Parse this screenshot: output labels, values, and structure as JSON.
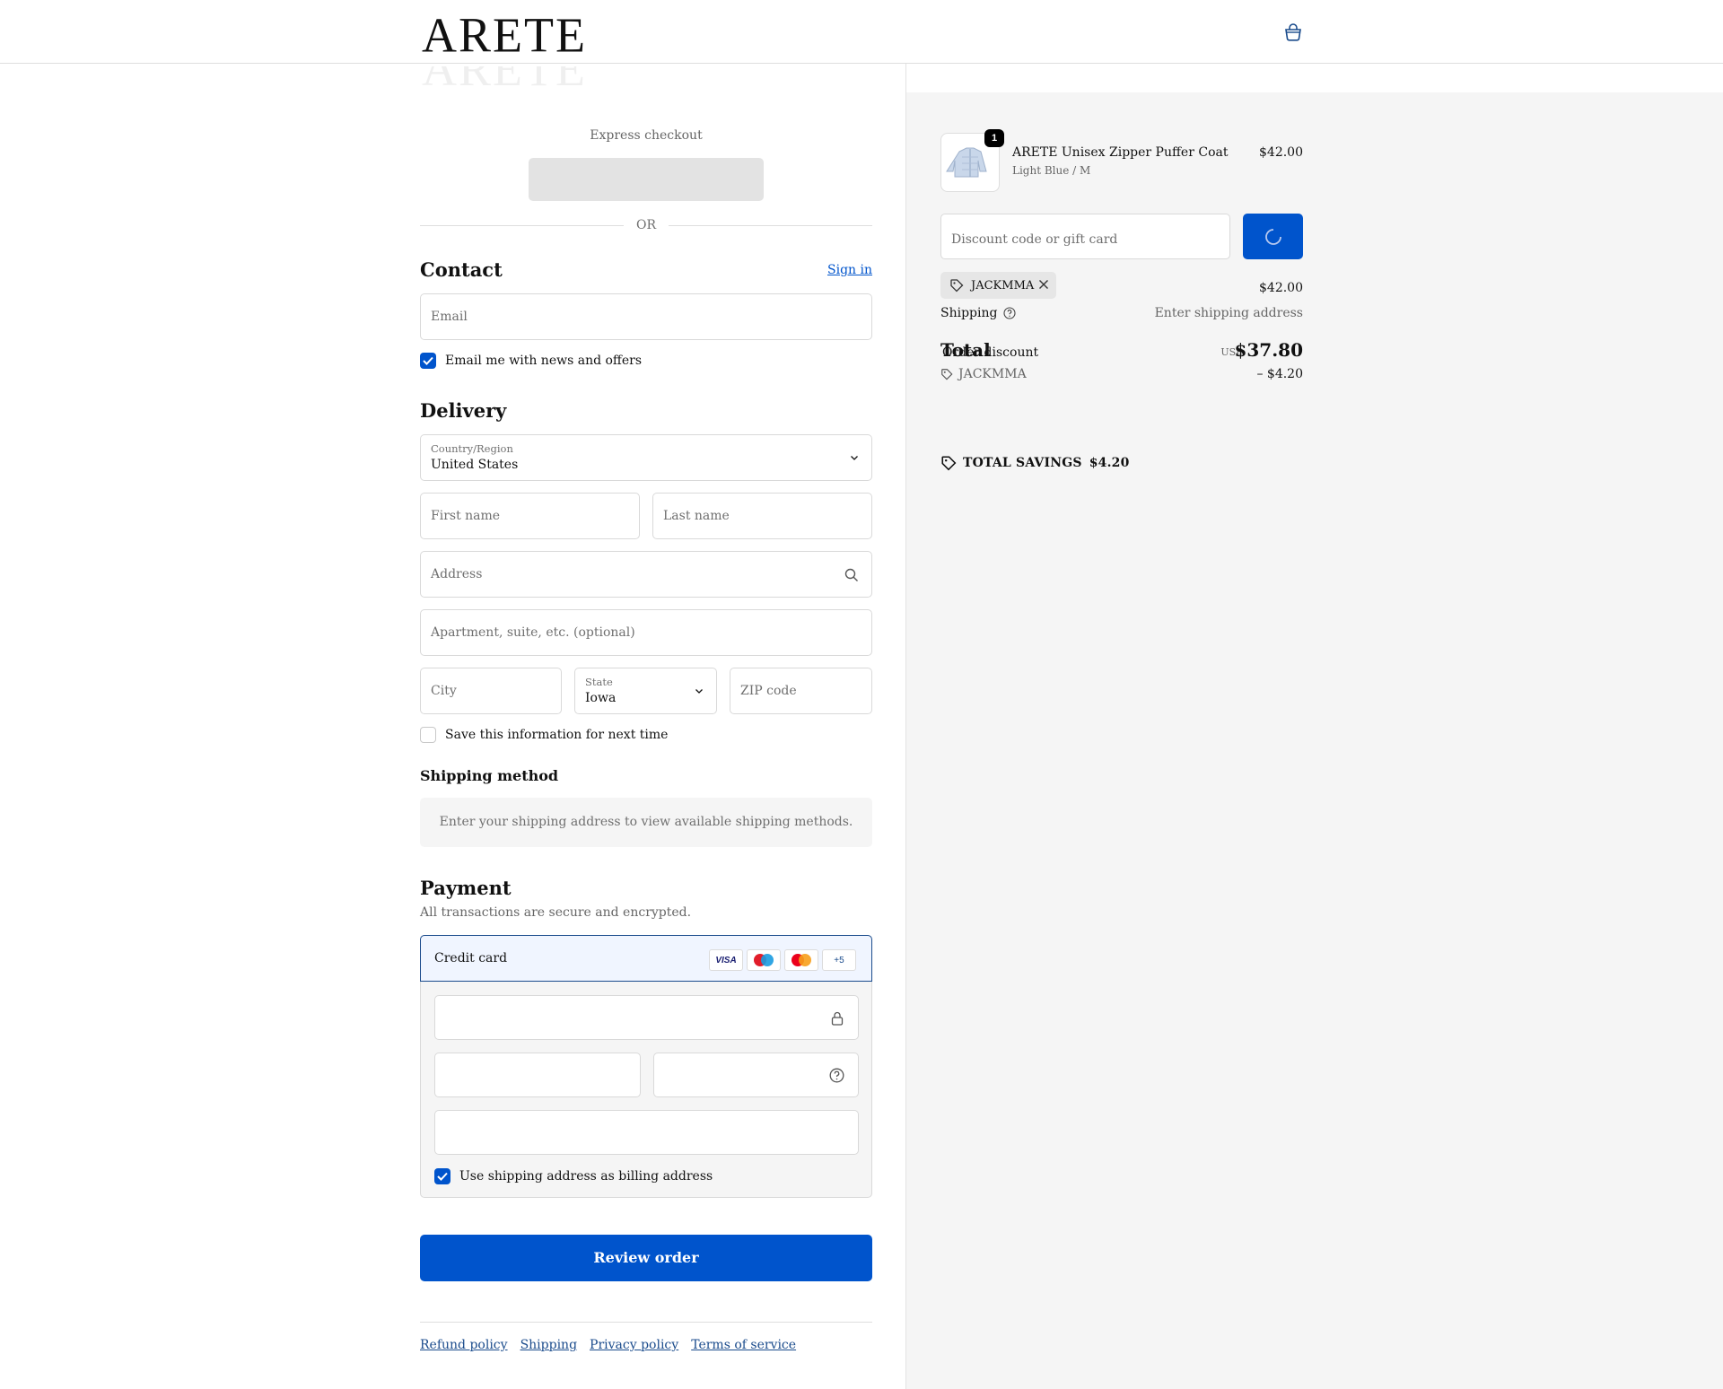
{
  "brand": {
    "logo_text": "ARETE"
  },
  "express": {
    "label": "Express checkout",
    "or_text": "OR"
  },
  "contact": {
    "title": "Contact",
    "sign_in": "Sign in",
    "email_placeholder": "Email",
    "news_label": "Email me with news and offers",
    "news_checked": true
  },
  "delivery": {
    "title": "Delivery",
    "country_label": "Country/Region",
    "country_value": "United States",
    "first_name_placeholder": "First name",
    "last_name_placeholder": "Last name",
    "address_placeholder": "Address",
    "apartment_placeholder": "Apartment, suite, etc. (optional)",
    "city_placeholder": "City",
    "state_label": "State",
    "state_value": "Iowa",
    "zip_placeholder": "ZIP code",
    "save_info_label": "Save this information for next time",
    "save_info_checked": false
  },
  "shipping_method": {
    "title": "Shipping method",
    "info": "Enter your shipping address to view available shipping methods."
  },
  "payment": {
    "title": "Payment",
    "subtitle": "All transactions are secure and encrypted.",
    "method_label": "Credit card",
    "card_logos": [
      "VISA",
      "maestro",
      "mastercard",
      "+5"
    ],
    "billing_label": "Use shipping address as billing address",
    "billing_checked": true,
    "review_button": "Review order"
  },
  "footer": {
    "links": [
      "Refund policy",
      "Shipping",
      "Privacy policy",
      "Terms of service"
    ]
  },
  "summary": {
    "item": {
      "quantity": "1",
      "name": "ARETE Unisex Zipper Puffer Coat",
      "variant": "Light Blue / M",
      "price": "$42.00"
    },
    "discount_placeholder": "Discount code or gift card",
    "applied_code": "JACKMMA",
    "subtotal_value": "$42.00",
    "shipping_label": "Shipping",
    "shipping_value": "Enter shipping address",
    "order_discount_label": "Order discount",
    "discount_code_line": "JACKMMA",
    "discount_amount": "– $4.20",
    "total_label": "Total",
    "currency": "USD",
    "total_value": "$37.80",
    "savings_label": "TOTAL SAVINGS",
    "savings_value": "$4.20"
  },
  "colors": {
    "accent": "#0054cc",
    "link": "#1a4b8c",
    "summary_bg": "#f5f5f5"
  }
}
